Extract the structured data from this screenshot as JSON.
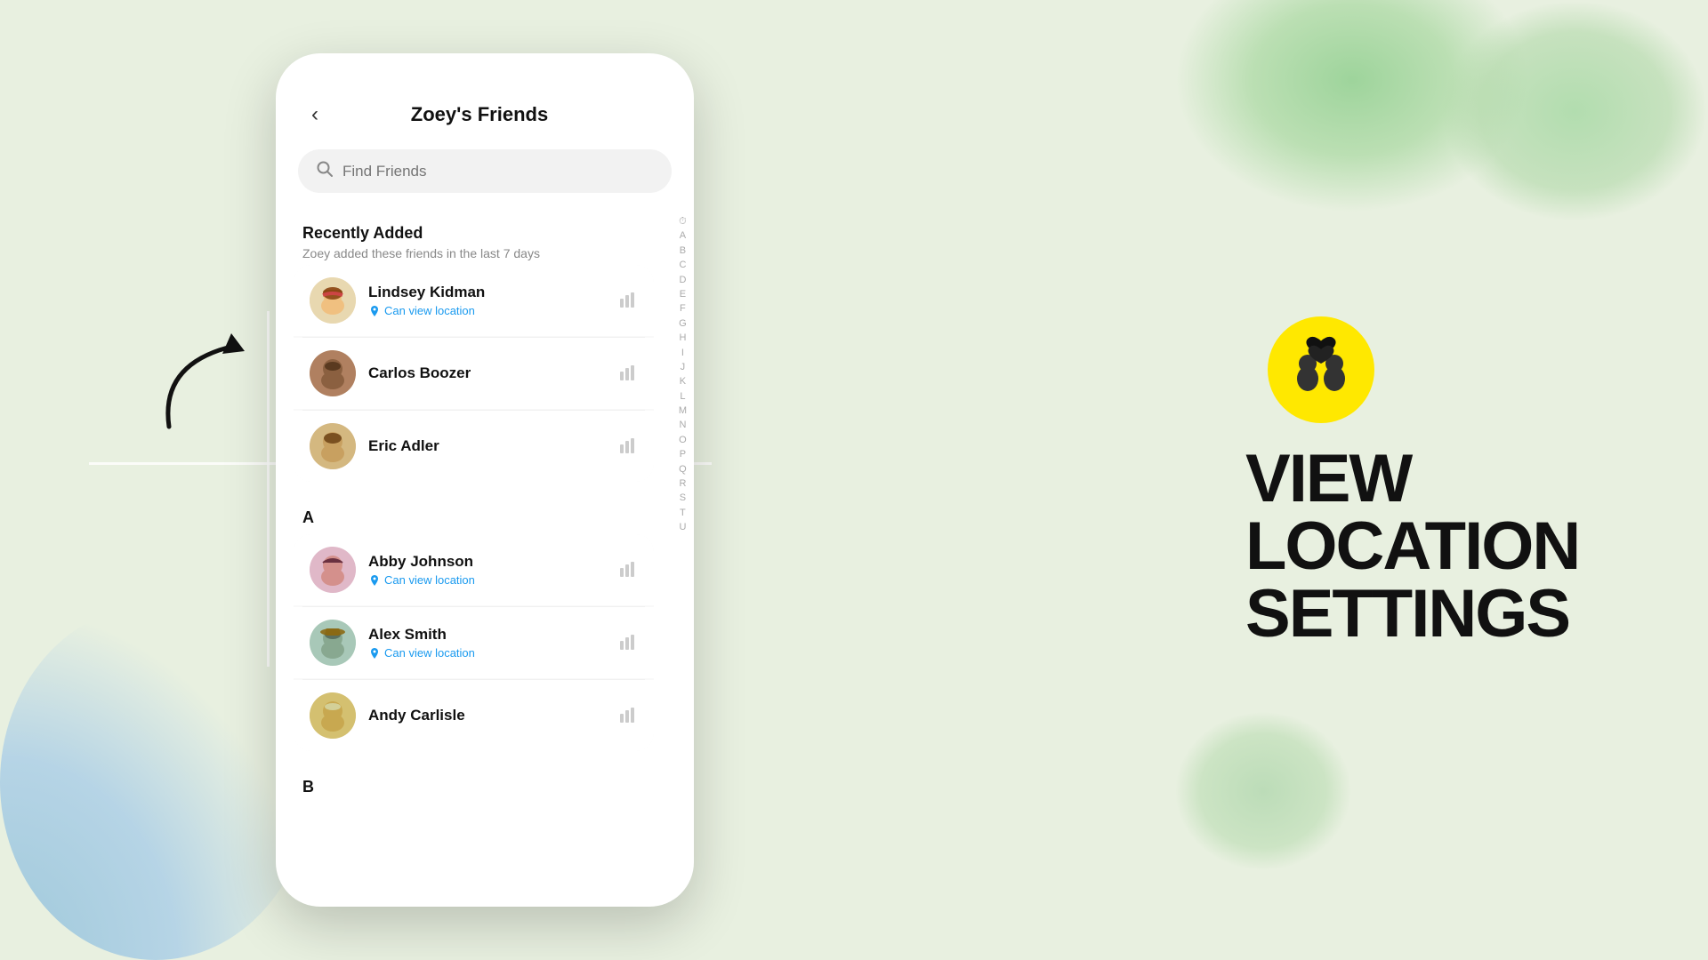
{
  "background": {
    "color": "#e8f0e0"
  },
  "page_title": "Zoey's Friends",
  "search": {
    "placeholder": "Find Friends"
  },
  "recently_added": {
    "title": "Recently Added",
    "subtitle": "Zoey added these friends in the last 7 days",
    "friends": [
      {
        "name": "Lindsey Kidman",
        "status": "Can view location",
        "has_location": true,
        "avatar_color": "#e8d8b0",
        "avatar_emoji": "👩"
      },
      {
        "name": "Carlos Boozer",
        "status": null,
        "has_location": false,
        "avatar_color": "#c09870",
        "avatar_emoji": "👨"
      },
      {
        "name": "Eric Adler",
        "status": null,
        "has_location": false,
        "avatar_color": "#d4b880",
        "avatar_emoji": "🧑"
      }
    ]
  },
  "alpha_sections": [
    {
      "letter": "A",
      "friends": [
        {
          "name": "Abby Johnson",
          "status": "Can view location",
          "has_location": true,
          "avatar_color": "#e0b8c8"
        },
        {
          "name": "Alex Smith",
          "status": "Can view location",
          "has_location": true,
          "avatar_color": "#a8c8b8"
        },
        {
          "name": "Andy Carlisle",
          "status": null,
          "has_location": false,
          "avatar_color": "#d4c070"
        }
      ]
    },
    {
      "letter": "B",
      "friends": []
    }
  ],
  "alphabet_index": [
    "⏱",
    "A",
    "B",
    "C",
    "D",
    "E",
    "F",
    "G",
    "H",
    "I",
    "J",
    "K",
    "L",
    "M",
    "N",
    "O",
    "P",
    "Q",
    "R",
    "S",
    "T",
    "U"
  ],
  "right_panel": {
    "icon_label": "friends-location-icon",
    "title_line1": "VIEW LOCATION",
    "title_line2": "SETTINGS"
  },
  "back_button_label": "‹"
}
